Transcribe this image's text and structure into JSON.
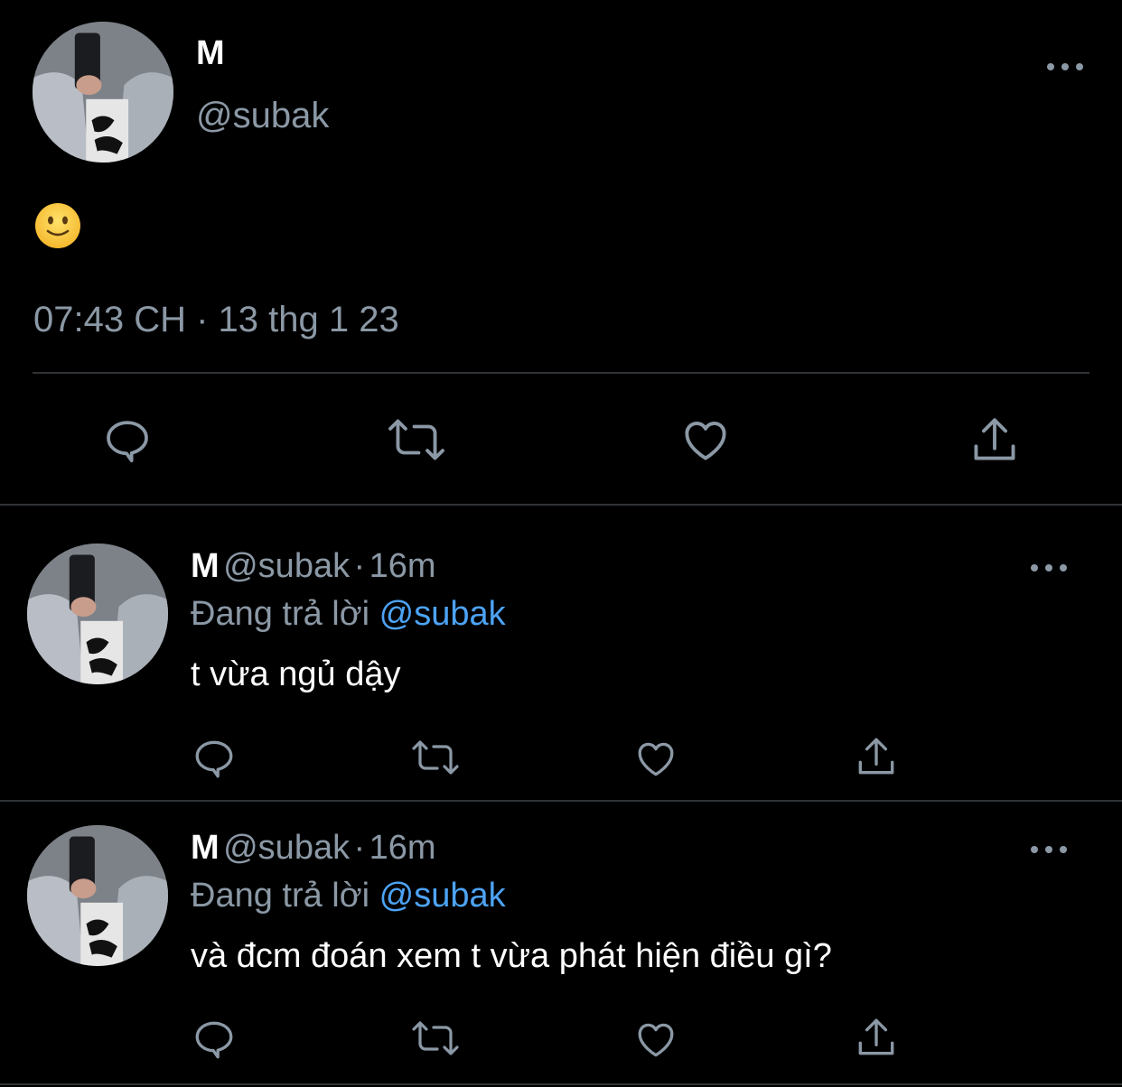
{
  "main_tweet": {
    "name": "M",
    "handle": "@subak",
    "emoji": "🙂",
    "timestamp": "07:43 CH · 13 thg 1 23"
  },
  "replies": [
    {
      "name": "M",
      "handle": "@subak",
      "separator": "·",
      "time": "16m",
      "replying_label": "Đang trả lời",
      "replying_to": "@subak",
      "text": "t vừa ngủ dậy"
    },
    {
      "name": "M",
      "handle": "@subak",
      "separator": "·",
      "time": "16m",
      "replying_label": "Đang trả lời",
      "replying_to": "@subak",
      "text": "và đcm đoán xem t vừa phát hiện điều gì?"
    }
  ],
  "icons": {
    "reply": "comment-icon",
    "retweet": "retweet-icon",
    "like": "heart-icon",
    "share": "share-icon",
    "more": "more-icon"
  },
  "colors": {
    "background": "#000000",
    "secondary_text": "#8b98a5",
    "link": "#4da3f5",
    "divider": "#2f3336"
  }
}
